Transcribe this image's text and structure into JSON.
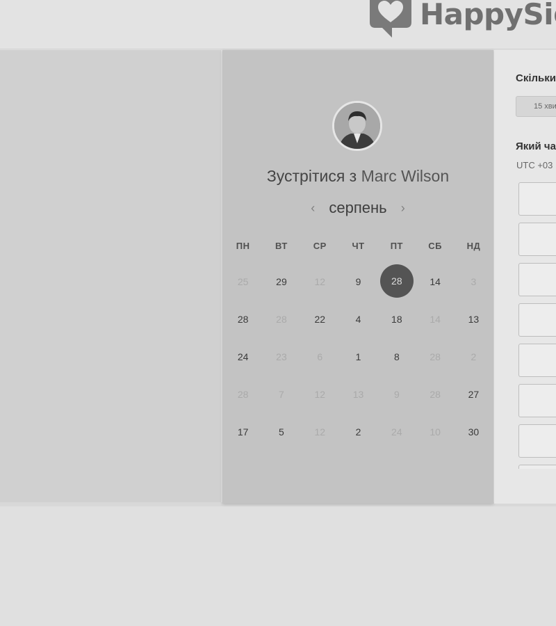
{
  "brand": {
    "name": "HappySig"
  },
  "calendar": {
    "meet_prefix": "Зустрітися з",
    "person_name": "Marc Wilson",
    "month": "серпень",
    "prev": "‹",
    "next": "›",
    "weekdays": [
      "ПН",
      "ВТ",
      "СР",
      "ЧТ",
      "ПТ",
      "СБ",
      "НД"
    ],
    "weeks": [
      [
        {
          "d": "25",
          "a": false
        },
        {
          "d": "29",
          "a": true
        },
        {
          "d": "12",
          "a": false
        },
        {
          "d": "9",
          "a": true
        },
        {
          "d": "28",
          "a": true,
          "s": true
        },
        {
          "d": "14",
          "a": true
        },
        {
          "d": "3",
          "a": false
        }
      ],
      [
        {
          "d": "28",
          "a": true
        },
        {
          "d": "28",
          "a": false
        },
        {
          "d": "22",
          "a": true
        },
        {
          "d": "4",
          "a": true
        },
        {
          "d": "18",
          "a": true
        },
        {
          "d": "14",
          "a": false
        },
        {
          "d": "13",
          "a": true
        }
      ],
      [
        {
          "d": "24",
          "a": true
        },
        {
          "d": "23",
          "a": false
        },
        {
          "d": "6",
          "a": false
        },
        {
          "d": "1",
          "a": true
        },
        {
          "d": "8",
          "a": true
        },
        {
          "d": "28",
          "a": false
        },
        {
          "d": "2",
          "a": false
        }
      ],
      [
        {
          "d": "28",
          "a": false
        },
        {
          "d": "7",
          "a": false
        },
        {
          "d": "12",
          "a": false
        },
        {
          "d": "13",
          "a": false
        },
        {
          "d": "9",
          "a": false
        },
        {
          "d": "28",
          "a": false
        },
        {
          "d": "27",
          "a": true
        }
      ],
      [
        {
          "d": "17",
          "a": true
        },
        {
          "d": "5",
          "a": true
        },
        {
          "d": "12",
          "a": false
        },
        {
          "d": "2",
          "a": true
        },
        {
          "d": "24",
          "a": false
        },
        {
          "d": "10",
          "a": false
        },
        {
          "d": "30",
          "a": true
        }
      ]
    ]
  },
  "booking": {
    "duration_question": "Скільки",
    "duration_value": "15 хви",
    "time_question": "Який ча",
    "timezone": "UTC +03",
    "slot_count": 8
  },
  "colors": {
    "selected_day_bg": "#545454",
    "calendar_bg": "#c3c3c3",
    "left_panel_bg": "#d0d0d0"
  }
}
